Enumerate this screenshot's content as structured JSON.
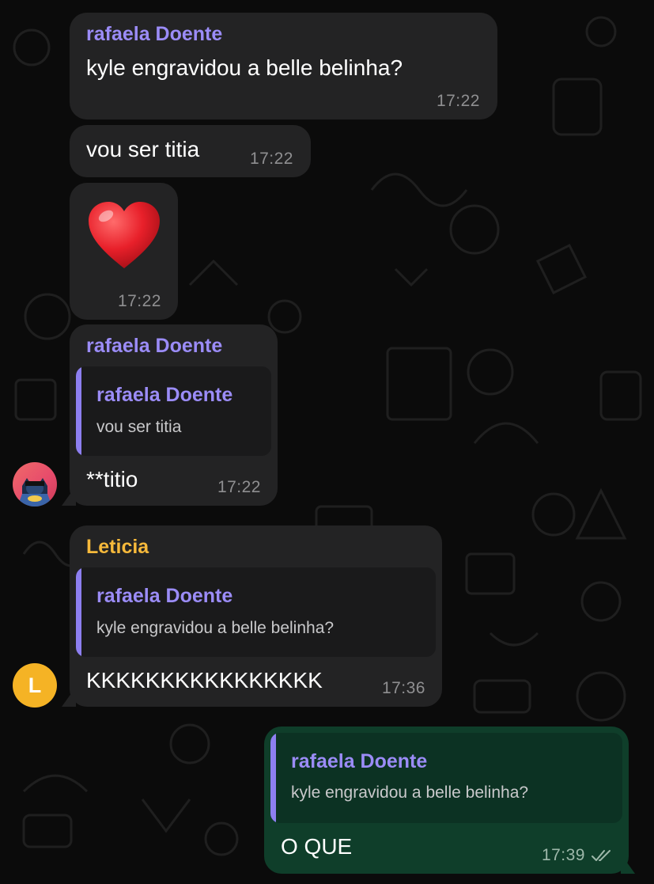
{
  "messages": [
    {
      "sender": "rafaela Doente",
      "text": "kyle engravidou a belle belinha?",
      "time": "17:22"
    },
    {
      "text": "vou ser titia",
      "time": "17:22"
    },
    {
      "emoji": "❤️",
      "emoji_name": "red-heart-emoji",
      "time": "17:22"
    },
    {
      "sender": "rafaela Doente",
      "quote": {
        "sender": "rafaela Doente",
        "text": "vou ser titia"
      },
      "text": "**titio",
      "time": "17:22"
    },
    {
      "sender": "Leticia",
      "quote": {
        "sender": "rafaela Doente",
        "text": "kyle engravidou a belle belinha?"
      },
      "text": "KKKKKKKKKKKKKKKK",
      "time": "17:36",
      "avatar_letter": "L"
    },
    {
      "outgoing": true,
      "quote": {
        "sender": "rafaela Doente",
        "text": "kyle engravidou a belle belinha?"
      },
      "text": "O QUE",
      "time": "17:39",
      "status_icon": "double-check-icon"
    }
  ],
  "colors": {
    "background": "#0b0b0b",
    "incoming_bubble": "#232324",
    "outgoing_bubble": "#0f3e2a",
    "sender_purple": "#9b8cf7",
    "sender_yellow": "#f6b93b",
    "avatar_yellow": "#f5b325"
  }
}
